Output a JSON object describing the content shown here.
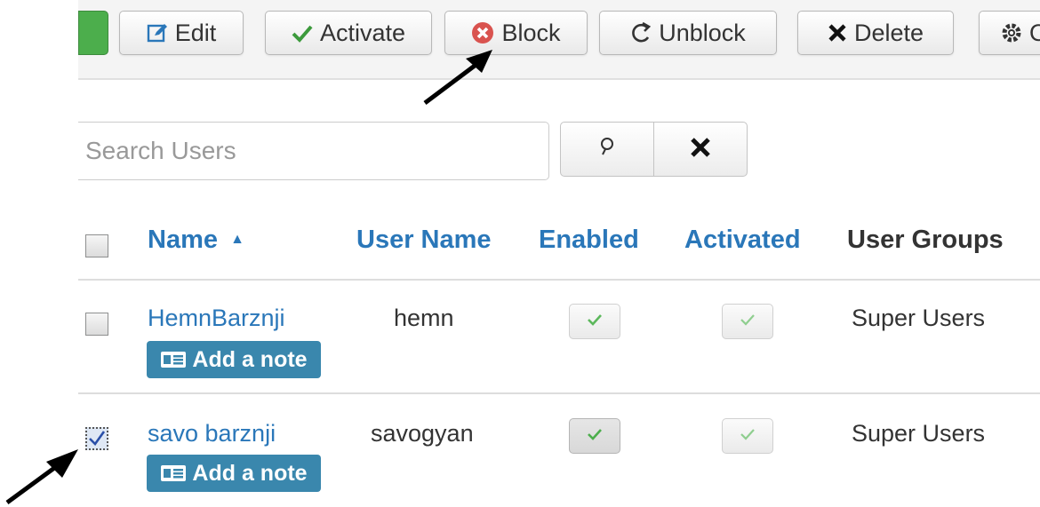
{
  "toolbar": {
    "edit_label": "Edit",
    "activate_label": "Activate",
    "block_label": "Block",
    "unblock_label": "Unblock",
    "delete_label": "Delete",
    "options_label": "O"
  },
  "search": {
    "placeholder": "Search Users",
    "value": ""
  },
  "table": {
    "columns": {
      "name": "Name",
      "username": "User Name",
      "enabled": "Enabled",
      "activated": "Activated",
      "groups": "User Groups"
    },
    "sort_indicator": "▲",
    "rows": [
      {
        "name": "HemnBarznji",
        "username": "hemn",
        "enabled": true,
        "activated": true,
        "groups": "Super Users",
        "note_label": "Add a note",
        "selected": false
      },
      {
        "name": "savo barznji",
        "username": "savogyan",
        "enabled": true,
        "activated": true,
        "groups": "Super Users",
        "note_label": "Add a note",
        "selected": true
      }
    ]
  },
  "colors": {
    "link": "#2a77b9",
    "note_button": "#3a87ad",
    "check_green": "#5cb85c",
    "block_red": "#d9534f",
    "activate_green": "#3c9a3c"
  },
  "icons": [
    "edit-icon",
    "check-icon",
    "block-icon",
    "unblock-icon",
    "delete-icon",
    "gear-icon",
    "search-icon",
    "close-icon",
    "note-icon",
    "arrow-annotation"
  ]
}
